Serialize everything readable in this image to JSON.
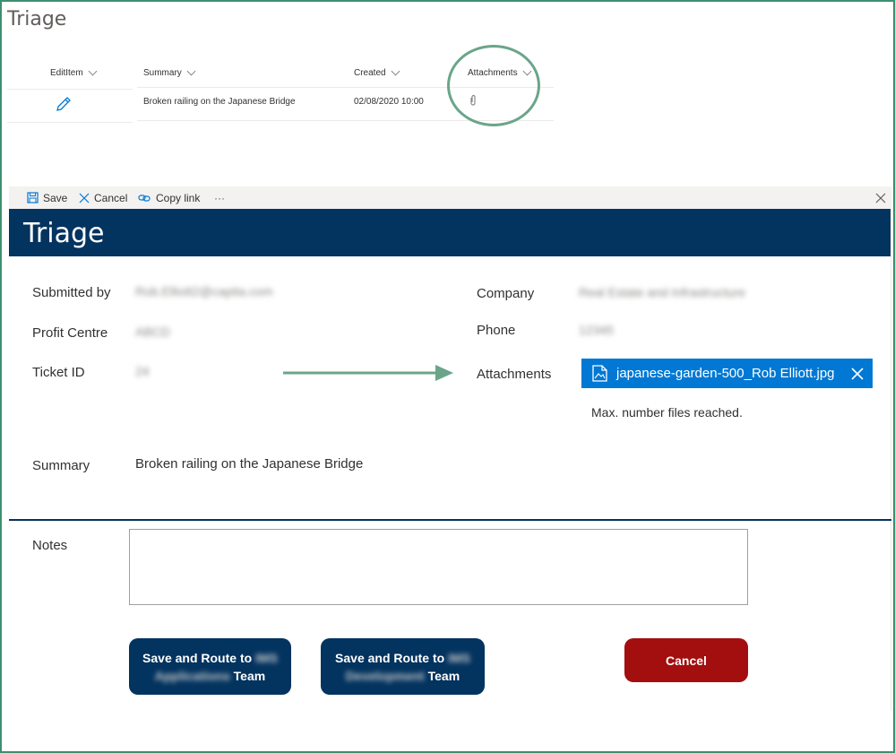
{
  "list": {
    "title": "Triage",
    "columns": [
      "EditItem",
      "Summary",
      "Created",
      "Attachments"
    ],
    "row": {
      "summary": "Broken railing on the Japanese Bridge",
      "created": "02/08/2020 10:00"
    }
  },
  "toolbar": {
    "save_label": "Save",
    "cancel_label": "Cancel",
    "copy_link_label": "Copy link",
    "more_label": "···"
  },
  "form": {
    "title": "Triage",
    "fields": {
      "submitted_by": {
        "label": "Submitted by",
        "value": "Rob.Elliott2@capita.com"
      },
      "profit_centre": {
        "label": "Profit Centre",
        "value": "ABCD"
      },
      "ticket_id": {
        "label": "Ticket ID",
        "value": "24"
      },
      "company": {
        "label": "Company",
        "value": "Real Estate and Infrastructure"
      },
      "phone": {
        "label": "Phone",
        "value": "12345"
      },
      "attachments": {
        "label": "Attachments",
        "file_name": "japanese-garden-500_Rob Elliott.jpg",
        "message": "Max. number files reached."
      },
      "summary": {
        "label": "Summary",
        "value": "Broken railing on the Japanese Bridge"
      },
      "notes": {
        "label": "Notes",
        "value": ""
      }
    }
  },
  "buttons": {
    "route_apps": {
      "line1": "Save and Route to",
      "hidden1": "IMS",
      "hidden2": "Applications",
      "line2_suffix": "Team"
    },
    "route_dev": {
      "line1": "Save and Route to",
      "hidden1": "IMS",
      "hidden2": "Development",
      "line2_suffix": "Team"
    },
    "cancel": "Cancel"
  },
  "colors": {
    "banner": "#03335f",
    "chip": "#0078d4",
    "cancel": "#a30e0e",
    "annotation": "#6aa58a"
  }
}
